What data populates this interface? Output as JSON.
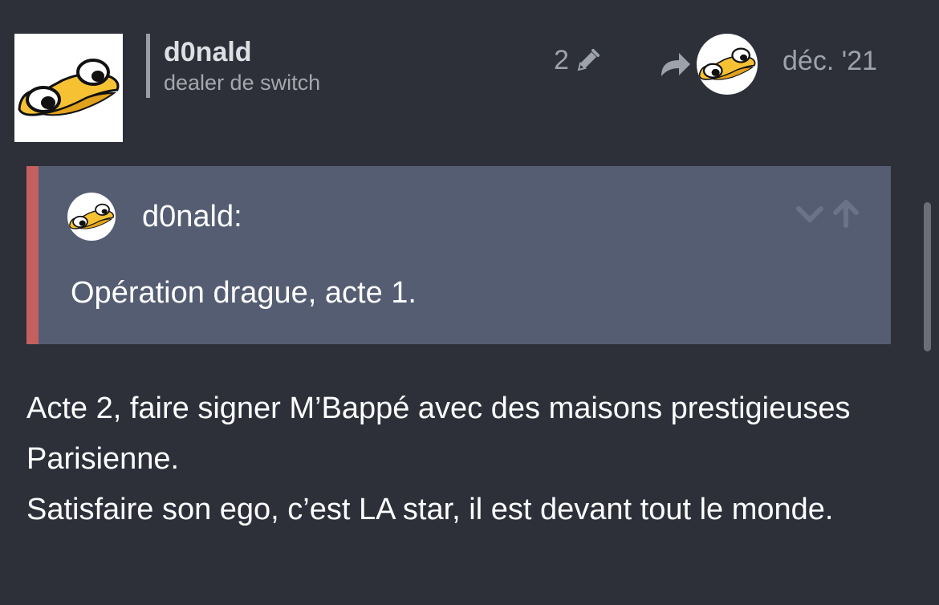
{
  "post": {
    "author": {
      "username": "d0nald",
      "title": "dealer de switch",
      "avatar_icon": "duck-avatar"
    },
    "edit_count": "2",
    "edit_icon": "pencil-icon",
    "reply_icon": "reply-arrow-icon",
    "reply_to_avatar_icon": "duck-avatar",
    "date": "déc. '21",
    "quote": {
      "username": "d0nald:",
      "text": "Opération drague, acte 1.",
      "expand_icon": "chevron-down-icon",
      "jump_icon": "arrow-up-icon"
    },
    "body": [
      "Acte 2, faire signer M’Bappé avec des maisons prestigieuses Parisienne.",
      "Satisfaire son ego, c’est LA star, il est devant tout le monde."
    ]
  },
  "colors": {
    "background": "#2d3039",
    "quote_background": "#555d73",
    "quote_border": "#c4605f",
    "muted_text": "#9ea2ab",
    "duck_yellow": "#f6c233"
  }
}
